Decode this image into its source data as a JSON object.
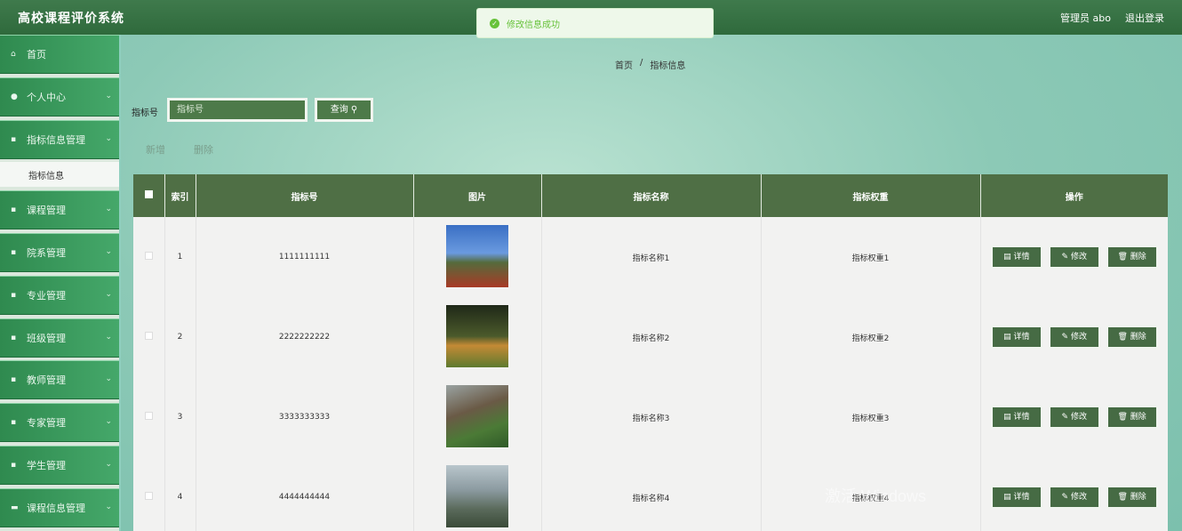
{
  "app": {
    "title": "高校课程评价系统"
  },
  "topbar": {
    "user_label": "管理员 abo",
    "logout_label": "退出登录"
  },
  "toast": {
    "message": "修改信息成功"
  },
  "sidebar": {
    "items": [
      {
        "label": "首页"
      },
      {
        "label": "个人中心"
      },
      {
        "label": "指标信息管理"
      },
      {
        "label": "课程管理"
      },
      {
        "label": "院系管理"
      },
      {
        "label": "专业管理"
      },
      {
        "label": "班级管理"
      },
      {
        "label": "教师管理"
      },
      {
        "label": "专家管理"
      },
      {
        "label": "学生管理"
      },
      {
        "label": "课程信息管理"
      }
    ],
    "sub_item": "指标信息"
  },
  "breadcrumb": {
    "home": "首页",
    "sep": "/",
    "current": "指标信息"
  },
  "search": {
    "label": "指标号",
    "placeholder": "指标号",
    "button": "查询"
  },
  "actions": {
    "add": "新增",
    "delete": "删除"
  },
  "table": {
    "headers": {
      "index": "索引",
      "code": "指标号",
      "image": "图片",
      "name": "指标名称",
      "weight": "指标权重",
      "ops": "操作"
    },
    "ops_labels": {
      "detail": "详情",
      "edit": "修改",
      "delete": "删除"
    },
    "rows": [
      {
        "index": "1",
        "code": "1111111111",
        "name": "指标名称1",
        "weight": "指标权重1"
      },
      {
        "index": "2",
        "code": "2222222222",
        "name": "指标名称2",
        "weight": "指标权重2"
      },
      {
        "index": "3",
        "code": "3333333333",
        "name": "指标名称3",
        "weight": "指标权重3"
      },
      {
        "index": "4",
        "code": "4444444444",
        "name": "指标名称4",
        "weight": "指标权重4"
      }
    ]
  },
  "watermark": "激活 Windows"
}
